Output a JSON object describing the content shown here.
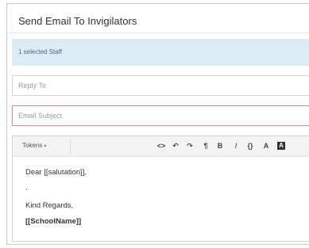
{
  "modal": {
    "title": "Send Email To Invigilators"
  },
  "recipients": {
    "summary": "1 selected Staff"
  },
  "reply_to": {
    "placeholder": "Reply To"
  },
  "subject": {
    "placeholder": "Email Subject"
  },
  "toolbar": {
    "tokens_label": "Tokens",
    "tokens_chevron": "▾",
    "code_view": "<>",
    "undo": "↶",
    "redo": "↷",
    "paragraph": "¶",
    "bold": "B",
    "italic": "I",
    "code": "{}",
    "font_color": "A",
    "highlight": "A"
  },
  "body": {
    "lines": [
      "Dear [[salutation]],",
      ".",
      "Kind Regards,",
      "[[SchoolName]]"
    ]
  },
  "colors": {
    "info_bar": "#dcecf5",
    "invalid_border": "#d98a8a"
  }
}
